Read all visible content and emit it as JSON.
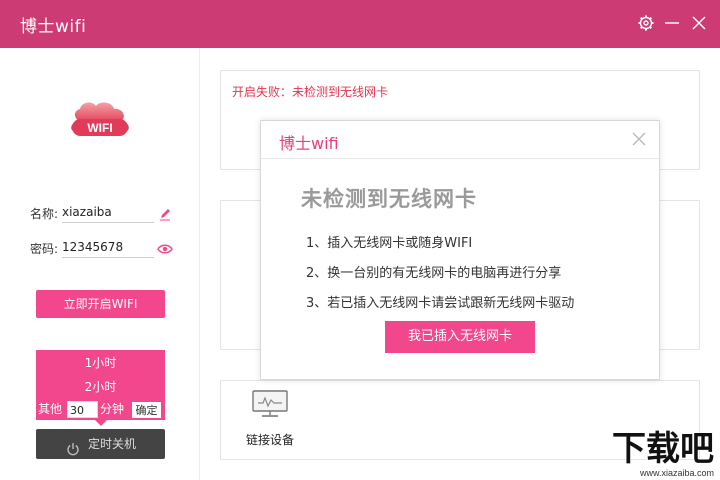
{
  "window": {
    "title": "博士wifi"
  },
  "login": {
    "name_label": "名称:",
    "name_value": "xiazaiba",
    "password_label": "密码:",
    "password_value": "12345678",
    "start_button": "立即开启WIFI"
  },
  "timer": {
    "options": [
      "1小时",
      "2小时"
    ],
    "other_label": "其他",
    "minutes_value": "30",
    "unit": "分钟",
    "confirm_label": "确定",
    "shutdown_label": "定时关机"
  },
  "status": {
    "message": "开启失败：未检测到无线网卡"
  },
  "devices": {
    "label": "链接设备"
  },
  "dialog": {
    "title": "博士wifi",
    "heading": "未检测到无线网卡",
    "steps": [
      "1、插入无线网卡或随身WIFI",
      "2、换一台别的有无线网卡的电脑再进行分享",
      "3、若已插入无线网卡请尝试跟新无线网卡驱动"
    ],
    "button_label": "我已插入无线网卡"
  },
  "logo_text": "WIFI",
  "watermark": {
    "text": "下载吧",
    "url": "www.xiazaiba.com"
  },
  "colors": {
    "titlebar": "#cc3b73",
    "accent": "#f2478c",
    "error": "#e3344f",
    "dark_button": "#444444"
  },
  "icons": [
    "gear-icon",
    "minimize-icon",
    "close-icon",
    "pencil-icon",
    "eye-icon",
    "power-icon",
    "monitor-icon",
    "wifi-cloud-logo"
  ]
}
